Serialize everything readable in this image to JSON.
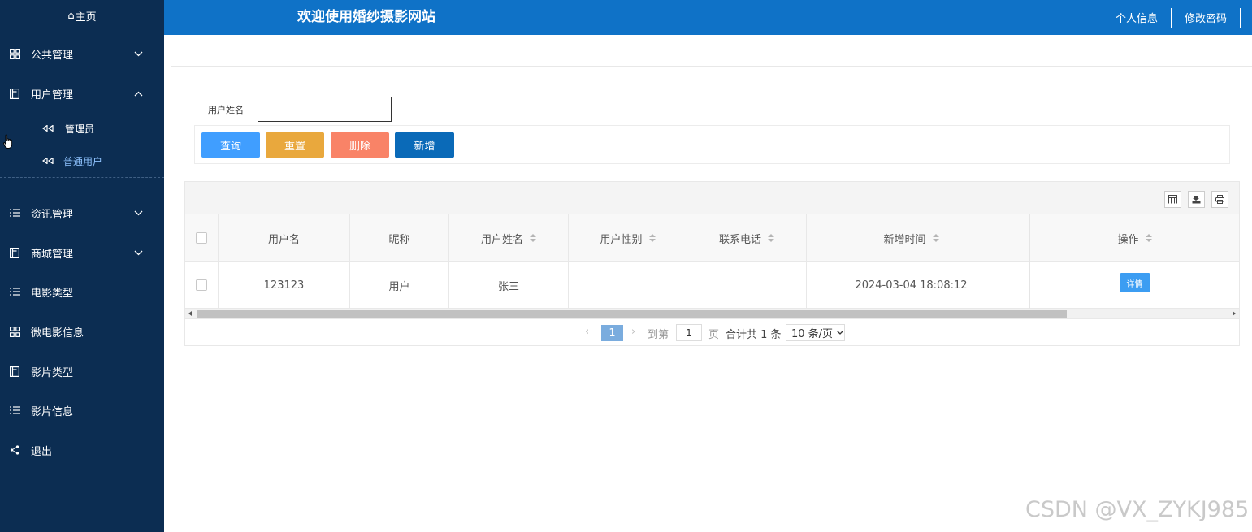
{
  "sidebar": {
    "home": "主页",
    "items": [
      {
        "label": "公共管理",
        "icon": "grid-icon"
      },
      {
        "label": "用户管理",
        "icon": "book-icon"
      },
      {
        "label": "资讯管理",
        "icon": "list-icon"
      },
      {
        "label": "商城管理",
        "icon": "book-icon"
      },
      {
        "label": "电影类型",
        "icon": "list-icon"
      },
      {
        "label": "微电影信息",
        "icon": "grid-icon"
      },
      {
        "label": "影片类型",
        "icon": "book-icon"
      },
      {
        "label": "影片信息",
        "icon": "list-icon"
      },
      {
        "label": "退出",
        "icon": "share-icon"
      }
    ],
    "subitems": [
      {
        "label": "管理员"
      },
      {
        "label": "普通用户"
      }
    ]
  },
  "header": {
    "title": "欢迎使用婚纱摄影网站",
    "personal": "个人信息",
    "change_password": "修改密码"
  },
  "search": {
    "label": "用户姓名",
    "value": ""
  },
  "buttons": {
    "query": "查询",
    "reset": "重置",
    "delete": "删除",
    "add": "新增"
  },
  "colors": {
    "sidebar_bg": "#0c2d52",
    "header_bg": "#0f72c7",
    "query": "#409eff",
    "reset": "#e9a83d",
    "delete": "#f98367",
    "add": "#0a6ab8"
  },
  "table": {
    "columns": [
      "用户名",
      "昵称",
      "用户姓名",
      "用户性别",
      "联系电话",
      "新增时间",
      "操作"
    ],
    "rows": [
      {
        "username": "123123",
        "nickname": "用户",
        "realname": "张三",
        "gender": "",
        "phone": "",
        "created": "2024-03-04 18:08:12",
        "action": "详情"
      }
    ]
  },
  "pagination": {
    "current": "1",
    "goto_label": "到第",
    "goto_value": "1",
    "page_unit": "页",
    "total": "合计共 1 条",
    "page_size": "10 条/页"
  },
  "watermark": "CSDN @VX_ZYKJ985"
}
